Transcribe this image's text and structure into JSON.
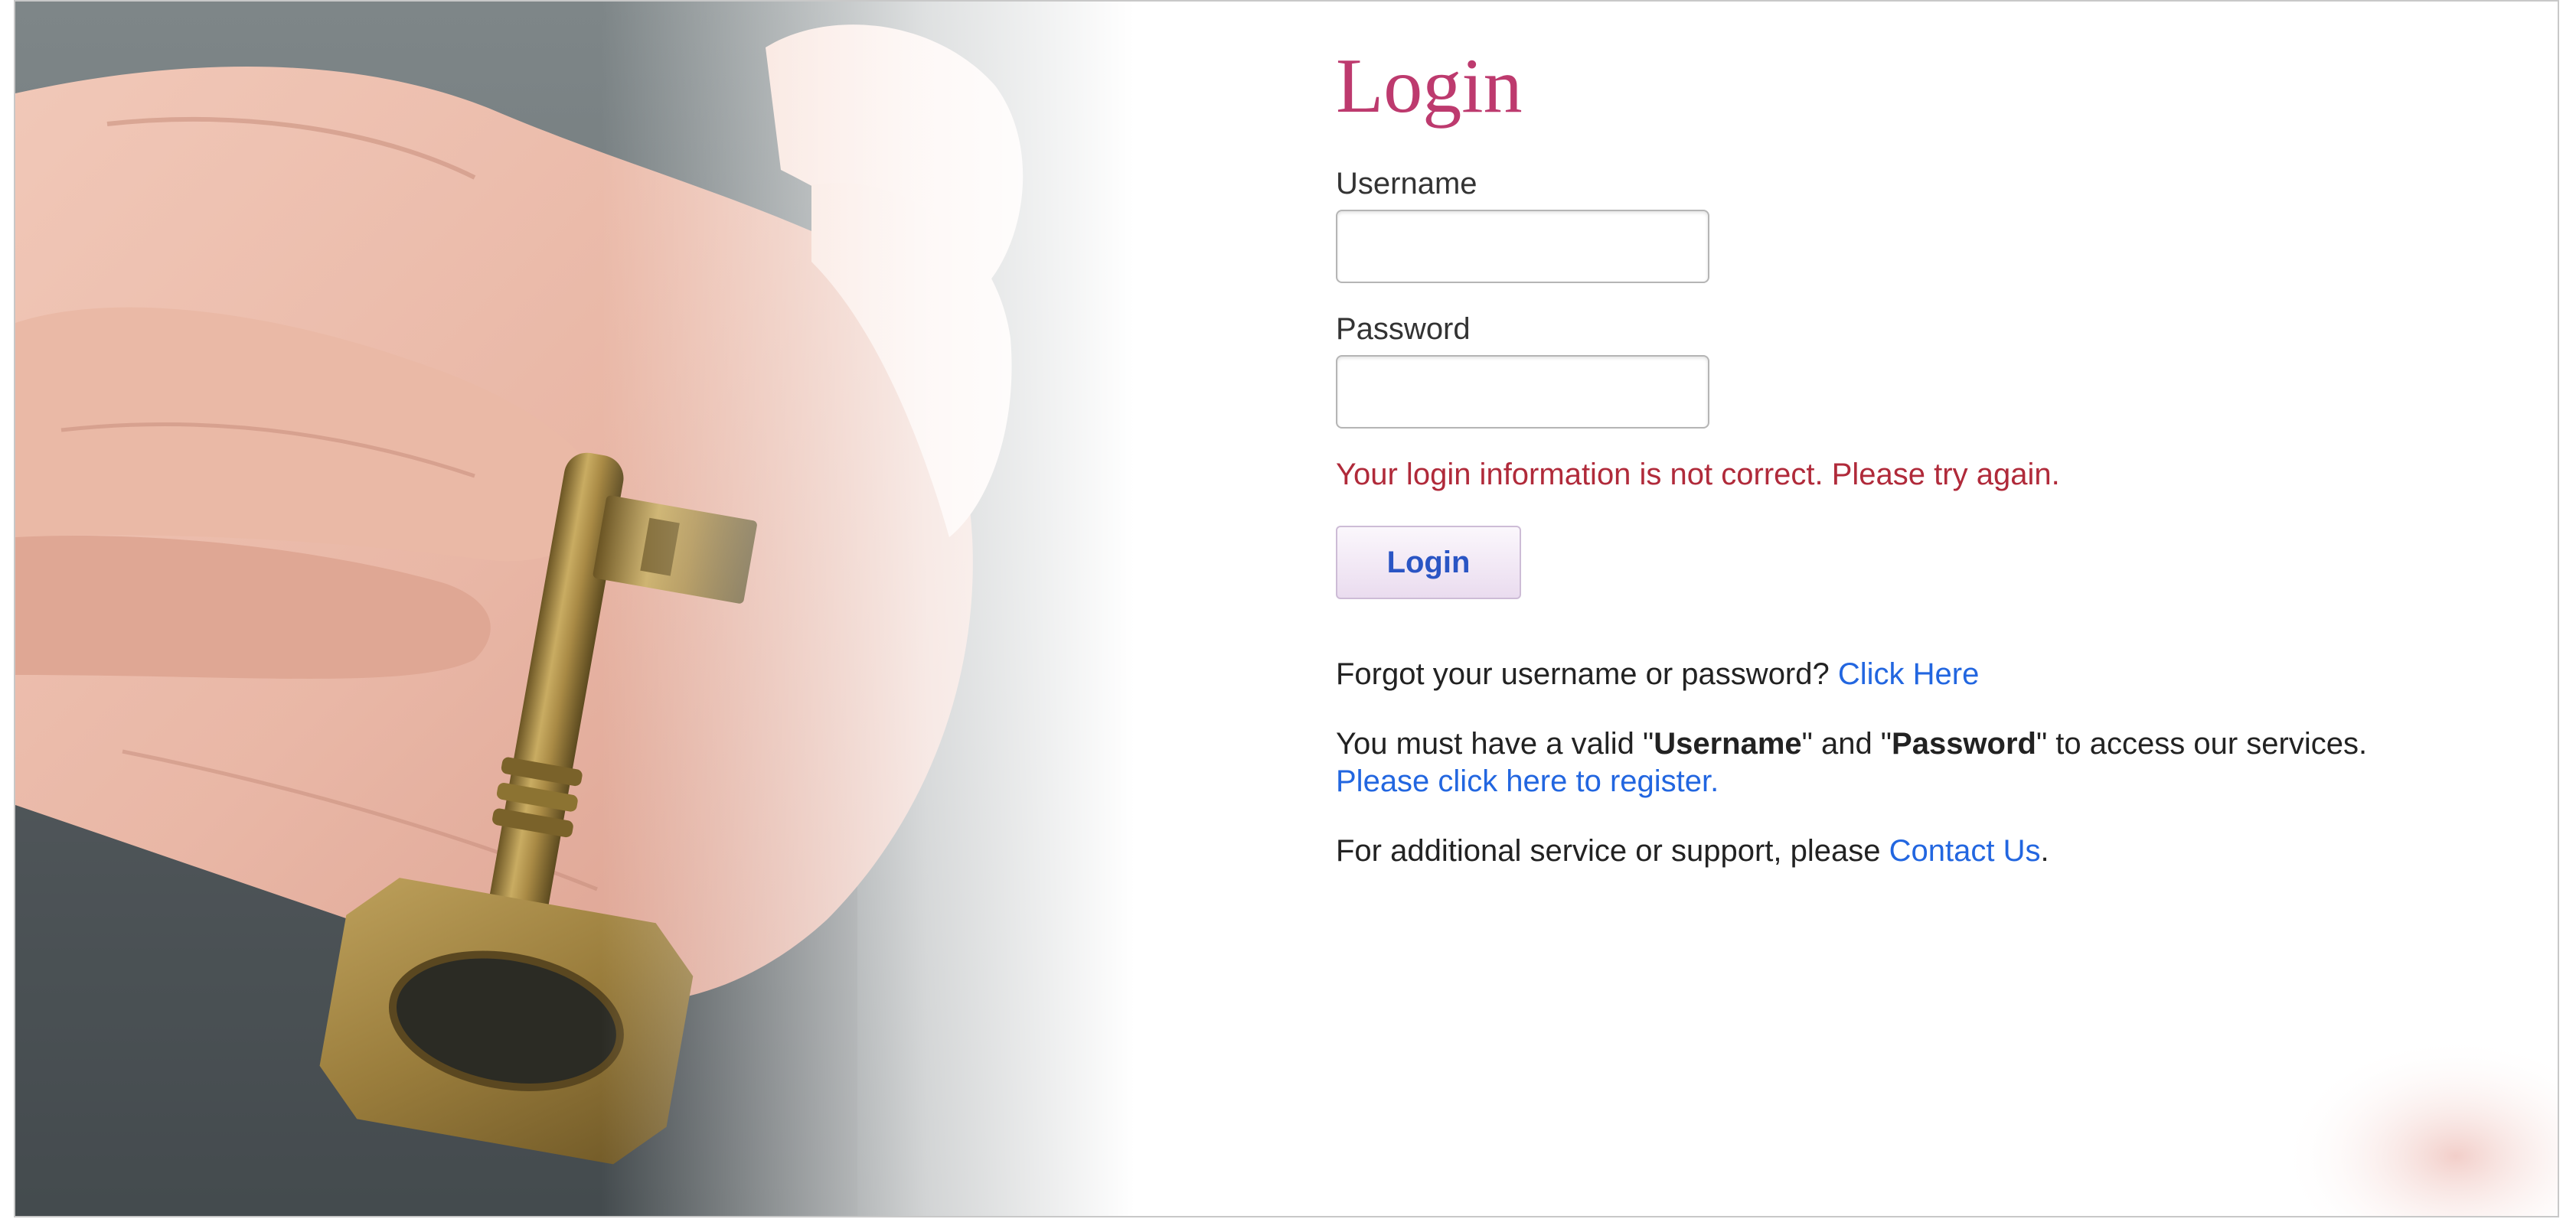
{
  "login": {
    "title": "Login",
    "username_label": "Username",
    "username_value": "",
    "password_label": "Password",
    "password_value": "",
    "error_message": "Your login information is not correct. Please try again.",
    "button_label": "Login"
  },
  "help": {
    "forgot_text": "Forgot your username or password?",
    "forgot_link": "Click Here",
    "must_have_prefix": "You must have a valid \"",
    "must_have_username": "Username",
    "must_have_and": "\" and \"",
    "must_have_password": "Password",
    "must_have_suffix": "\" to access our services.",
    "register_link": "Please click here to register.",
    "support_text": "For additional service or support, please",
    "contact_link": "Contact Us",
    "contact_period": "."
  },
  "colors": {
    "title": "#bd3a6e",
    "error": "#b02a3a",
    "link": "#2266e0",
    "button_text": "#2a55c4"
  }
}
